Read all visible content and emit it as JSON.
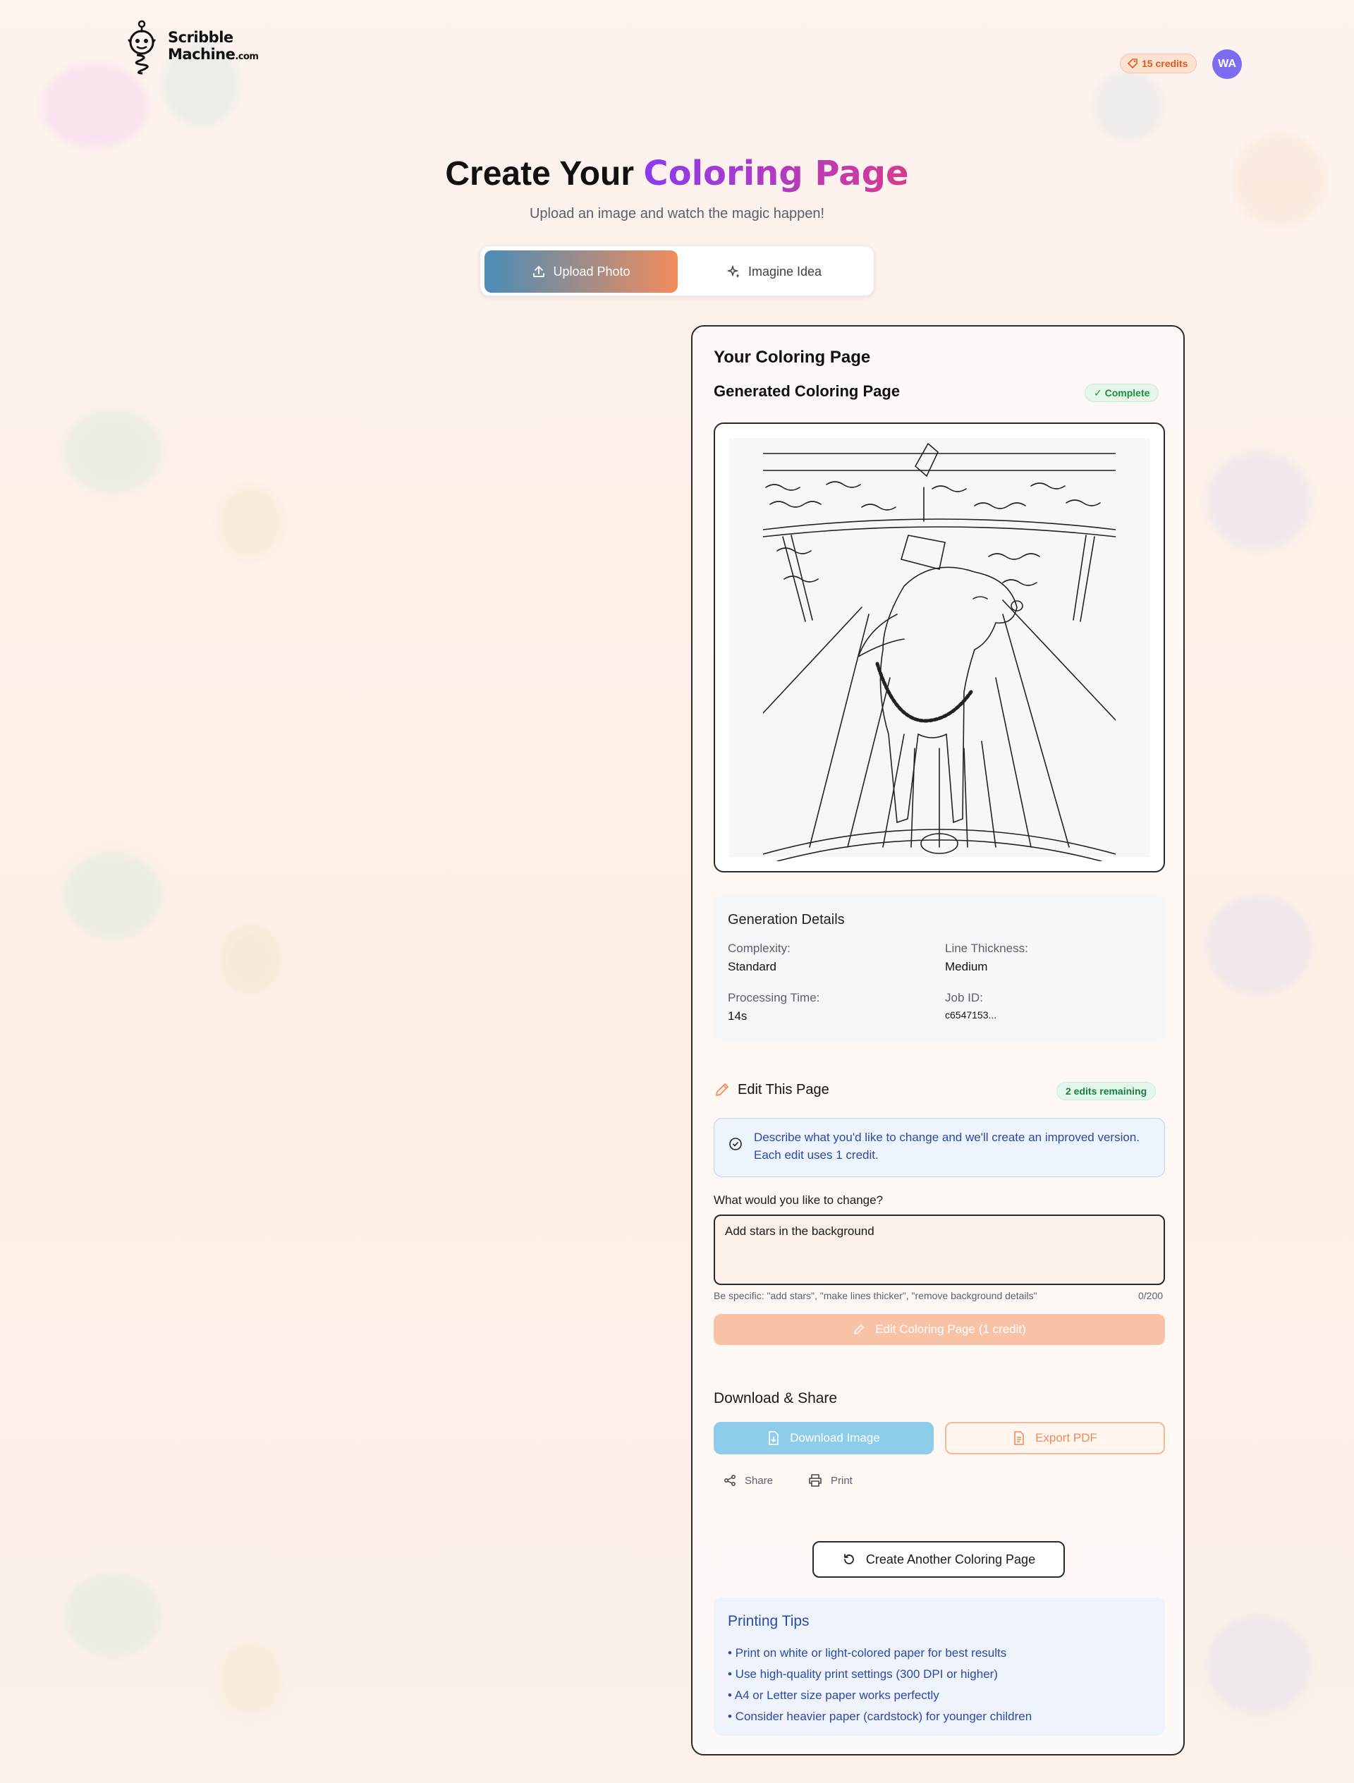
{
  "header": {
    "logo_line1": "Scribble",
    "logo_line2": "Machine",
    "logo_domain": ".com",
    "credits": "15 credits",
    "avatar_initials": "WA"
  },
  "hero": {
    "title_plain": "Create Your ",
    "title_accent": "Coloring Page",
    "subtitle": "Upload an image and watch the magic happen!",
    "mode_upload": "Upload Photo",
    "mode_imagine": "Imagine Idea"
  },
  "result": {
    "card_title": "Your Coloring Page",
    "generated_title": "Generated Coloring Page",
    "status": "✓ Complete"
  },
  "details": {
    "title": "Generation Details",
    "complexity_label": "Complexity:",
    "complexity_value": "Standard",
    "thickness_label": "Line Thickness:",
    "thickness_value": "Medium",
    "time_label": "Processing Time:",
    "time_value": "14s",
    "job_label": "Job ID:",
    "job_value": "c6547153..."
  },
  "edit": {
    "title": "Edit This Page",
    "remaining": "2 edits remaining",
    "info": "Describe what you'd like to change and we'll create an improved version. Each edit uses 1 credit.",
    "field_label": "What would you like to change?",
    "field_value": "Add stars in the background",
    "hint": "Be specific: \"add stars\", \"make lines thicker\", \"remove background details\"",
    "count": "0/200",
    "button": "Edit Coloring Page (1 credit)"
  },
  "download": {
    "title": "Download & Share",
    "download_btn": "Download Image",
    "pdf_btn": "Export PDF",
    "share": "Share",
    "print": "Print"
  },
  "another_btn": "Create Another Coloring Page",
  "tips": {
    "title": "Printing Tips",
    "items": [
      "• Print on white or light-colored paper for best results",
      "• Use high-quality print settings (300 DPI or higher)",
      "• A4 or Letter size paper works perfectly",
      "• Consider heavier paper (cardstock) for younger children"
    ]
  },
  "colors": {
    "brand_gradient_start": "#4a8cb8",
    "brand_gradient_end": "#f28c5c",
    "accent_purple": "#8a3cf0",
    "accent_pink": "#d63c8f",
    "avatar": "#7b6cf0"
  },
  "icons": [
    "logo-robot-icon",
    "credits-tag-icon",
    "upload-icon",
    "sparkles-icon",
    "pencil-icon",
    "info-circle-icon",
    "download-file-icon",
    "pdf-file-icon",
    "share-icon",
    "print-icon",
    "refresh-icon"
  ]
}
